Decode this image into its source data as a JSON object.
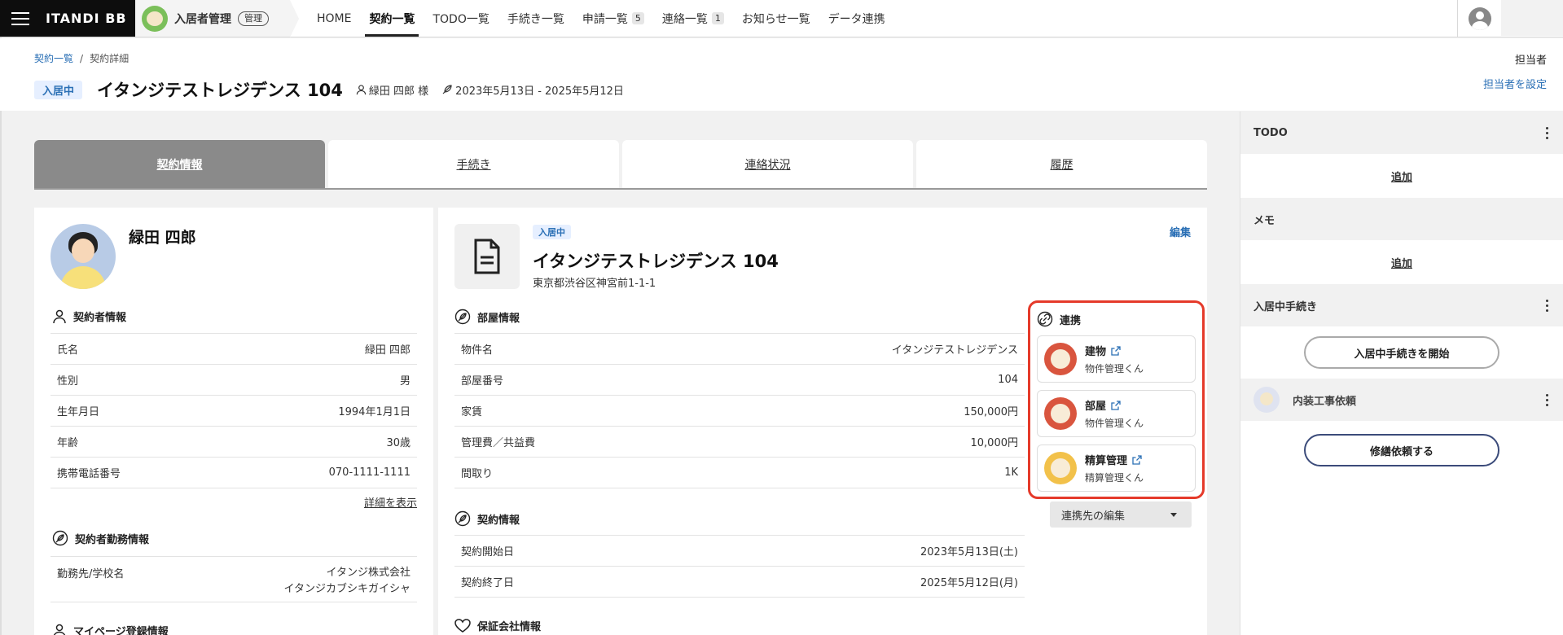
{
  "nav": {
    "brand": "ITANDI BB",
    "app_name": "入居者管理",
    "app_badge": "管理",
    "items": [
      {
        "label": "HOME",
        "count": null
      },
      {
        "label": "契約一覧",
        "count": null
      },
      {
        "label": "TODO一覧",
        "count": null
      },
      {
        "label": "手続き一覧",
        "count": null
      },
      {
        "label": "申請一覧",
        "count": "5"
      },
      {
        "label": "連絡一覧",
        "count": "1"
      },
      {
        "label": "お知らせ一覧",
        "count": null
      },
      {
        "label": "データ連携",
        "count": null
      }
    ]
  },
  "header": {
    "breadcrumb": [
      "契約一覧",
      "契約詳細"
    ],
    "status": "入居中",
    "title": "イタンジテストレジデンス 104",
    "tenant": "緑田 四郎 様",
    "period": "2023年5月13日 - 2025年5月12日",
    "assignee_label": "担当者",
    "assignee_link": "担当者を設定"
  },
  "tabs": [
    "契約情報",
    "手続き",
    "連絡状況",
    "履歴"
  ],
  "person": {
    "name": "緑田 四郎",
    "contractor_section": "契約者情報",
    "rows": [
      {
        "k": "氏名",
        "v": "緑田 四郎"
      },
      {
        "k": "性別",
        "v": "男"
      },
      {
        "k": "生年月日",
        "v": "1994年1月1日"
      },
      {
        "k": "年齢",
        "v": "30歳"
      },
      {
        "k": "携帯電話番号",
        "v": "070-1111-1111"
      }
    ],
    "details_link": "詳細を表示",
    "work_section": "契約者勤務情報",
    "work_rows": [
      {
        "k": "勤務先/学校名",
        "v1": "イタンジ株式会社",
        "v2": "イタンジカブシキガイシャ"
      }
    ],
    "mypage_section": "マイページ登録情報"
  },
  "property": {
    "status": "入居中",
    "name": "イタンジテストレジデンス 104",
    "address": "東京都渋谷区神宮前1-1-1",
    "edit": "編集",
    "room_section": "部屋情報",
    "room_rows": [
      {
        "k": "物件名",
        "v": "イタンジテストレジデンス"
      },
      {
        "k": "部屋番号",
        "v": "104"
      },
      {
        "k": "家賃",
        "v": "150,000円"
      },
      {
        "k": "管理費／共益費",
        "v": "10,000円"
      },
      {
        "k": "間取り",
        "v": "1K"
      }
    ],
    "contract_section": "契約情報",
    "contract_rows": [
      {
        "k": "契約開始日",
        "v": "2023年5月13日(土)"
      },
      {
        "k": "契約終了日",
        "v": "2025年5月12日(月)"
      }
    ],
    "guarantee_section": "保証会社情報"
  },
  "integration": {
    "title": "連携",
    "items": [
      {
        "title": "建物",
        "sub": "物件管理くん"
      },
      {
        "title": "部屋",
        "sub": "物件管理くん"
      },
      {
        "title": "精算管理",
        "sub": "精算管理くん"
      }
    ],
    "dropdown": "連携先の編集"
  },
  "side": {
    "todo_title": "TODO",
    "todo_add": "追加",
    "memo_title": "メモ",
    "memo_add": "追加",
    "moving_title": "入居中手続き",
    "moving_button": "入居中手続きを開始",
    "repair_title": "内装工事依頼",
    "repair_button": "修繕依頼する"
  },
  "colors": {
    "accent": "#2a6fb5",
    "highlight_border": "#e53a2a",
    "tab_active": "#8a8a8a"
  }
}
